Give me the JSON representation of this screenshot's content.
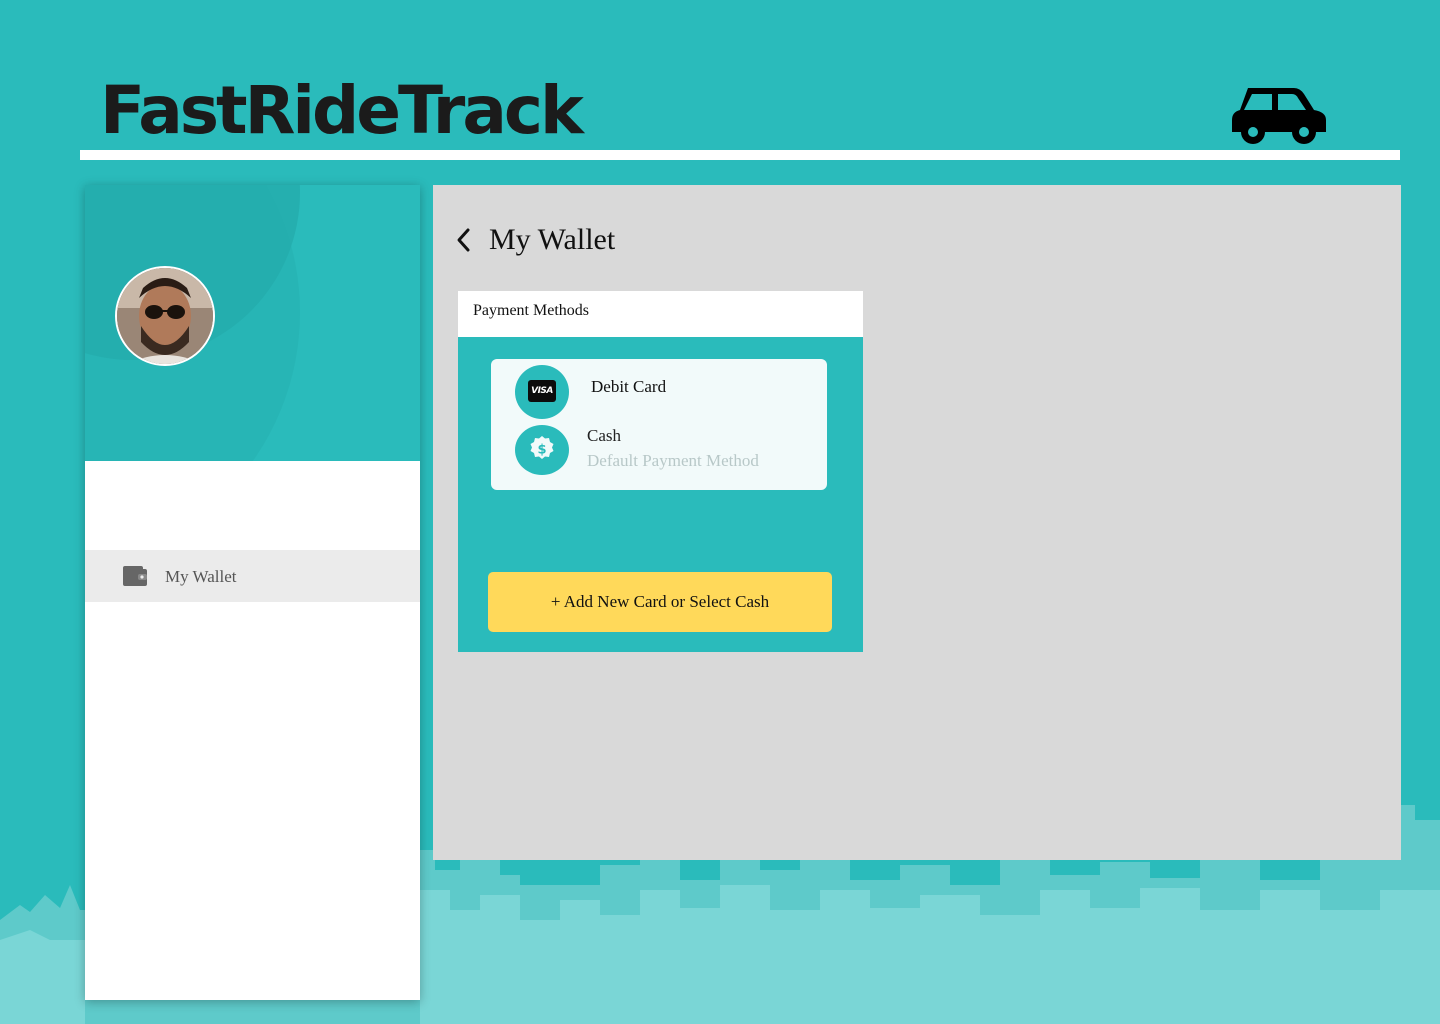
{
  "app": {
    "brand": "FastRideTrack"
  },
  "sidebar": {
    "items": [
      {
        "label": "My Wallet",
        "icon": "wallet-icon"
      }
    ]
  },
  "main": {
    "title": "My Wallet",
    "payment_methods": {
      "header": "Payment Methods",
      "methods": [
        {
          "label": "Debit Card",
          "icon": "visa-card-icon",
          "badge": "VISA"
        },
        {
          "label": "Cash",
          "sublabel": "Default Payment Method",
          "icon": "dollar-coin-icon"
        }
      ],
      "add_button": "+ Add New Card or Select Cash"
    }
  },
  "colors": {
    "background": "#2abbbb",
    "panel": "#d9d9d9",
    "accent_button": "#ffd95a",
    "text_dark": "#111111"
  }
}
